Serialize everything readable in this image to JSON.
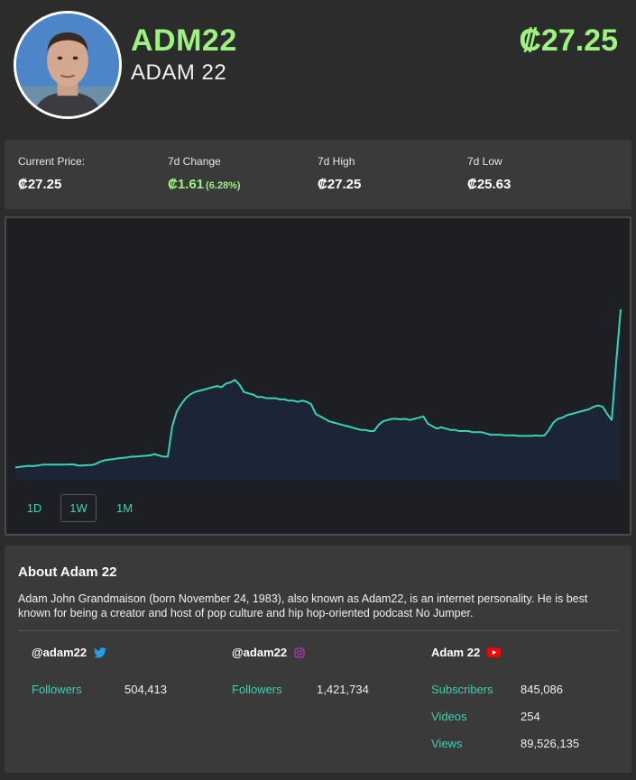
{
  "asset": {
    "ticker": "ADM22",
    "name": "ADAM 22",
    "price": "₡27.25"
  },
  "stats": {
    "current_price_label": "Current Price:",
    "current_price": "₡27.25",
    "change_label": "7d Change",
    "change": "₡1.61",
    "change_pct": "(6.28%)",
    "high_label": "7d High",
    "high": "₡27.25",
    "low_label": "7d Low",
    "low": "₡25.63"
  },
  "colors": {
    "accent_green": "#9cf37f",
    "line_teal": "#38d3b3",
    "twitter_blue": "#1da1f2",
    "instagram_purple": "#b33ab4",
    "youtube_red": "#ff0000"
  },
  "chart_data": {
    "type": "area",
    "period": "1W",
    "y": [
      0.05,
      0.053,
      0.055,
      0.057,
      0.056,
      0.058,
      0.062,
      0.062,
      0.062,
      0.062,
      0.062,
      0.062,
      0.063,
      0.063,
      0.058,
      0.058,
      0.06,
      0.06,
      0.065,
      0.075,
      0.08,
      0.083,
      0.085,
      0.088,
      0.09,
      0.092,
      0.095,
      0.095,
      0.097,
      0.098,
      0.1,
      0.105,
      0.1,
      0.095,
      0.095,
      0.22,
      0.28,
      0.31,
      0.335,
      0.35,
      0.36,
      0.365,
      0.37,
      0.375,
      0.38,
      0.385,
      0.38,
      0.395,
      0.4,
      0.41,
      0.39,
      0.36,
      0.355,
      0.35,
      0.34,
      0.34,
      0.335,
      0.335,
      0.335,
      0.33,
      0.33,
      0.325,
      0.325,
      0.32,
      0.325,
      0.32,
      0.31,
      0.27,
      0.26,
      0.25,
      0.24,
      0.235,
      0.23,
      0.225,
      0.22,
      0.215,
      0.21,
      0.205,
      0.205,
      0.2,
      0.2,
      0.225,
      0.24,
      0.245,
      0.25,
      0.25,
      0.248,
      0.25,
      0.245,
      0.25,
      0.255,
      0.26,
      0.23,
      0.22,
      0.21,
      0.215,
      0.21,
      0.205,
      0.205,
      0.2,
      0.2,
      0.2,
      0.195,
      0.195,
      0.195,
      0.19,
      0.185,
      0.185,
      0.185,
      0.183,
      0.182,
      0.183,
      0.18,
      0.18,
      0.18,
      0.18,
      0.182,
      0.18,
      0.182,
      0.205,
      0.235,
      0.25,
      0.255,
      0.265,
      0.27,
      0.275,
      0.28,
      0.285,
      0.29,
      0.3,
      0.305,
      0.3,
      0.27,
      0.245,
      0.48,
      0.7
    ],
    "grid": false
  },
  "ranges": [
    "1D",
    "1W",
    "1M"
  ],
  "active_range": "1W",
  "about": {
    "title": "About Adam 22",
    "description": "Adam John Grandmaison (born November 24, 1983), also known as Adam22, is an internet personality. He is best known for being a creator and host of pop culture and hip hop-oriented podcast No Jumper."
  },
  "social": {
    "twitter": {
      "handle": "@adam22",
      "icon": "twitter-icon",
      "followers_label": "Followers",
      "followers": "504,413"
    },
    "instagram": {
      "handle": "@adam22",
      "icon": "instagram-icon",
      "followers_label": "Followers",
      "followers": "1,421,734"
    },
    "youtube": {
      "handle": "Adam 22",
      "icon": "youtube-icon",
      "subscribers_label": "Subscribers",
      "subscribers": "845,086",
      "videos_label": "Videos",
      "videos": "254",
      "views_label": "Views",
      "views": "89,526,135"
    }
  }
}
